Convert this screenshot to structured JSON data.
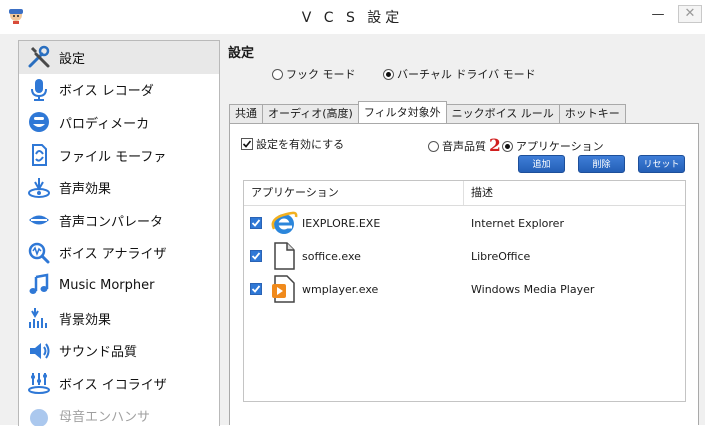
{
  "window": {
    "title": "V C S 設定",
    "minimize": "—",
    "close": "✕"
  },
  "sidebar": {
    "items": [
      {
        "label": "設定",
        "icon": "tools-icon"
      },
      {
        "label": "ボイス レコーダ",
        "icon": "microphone-icon"
      },
      {
        "label": "パロディメーカ",
        "icon": "parody-face-icon"
      },
      {
        "label": "ファイル モーファ",
        "icon": "file-morph-icon"
      },
      {
        "label": "音声効果",
        "icon": "voice-effect-icon"
      },
      {
        "label": "音声コンパレータ",
        "icon": "lips-compare-icon"
      },
      {
        "label": "ボイス アナライザ",
        "icon": "voice-analyzer-icon"
      },
      {
        "label": "Music Morpher",
        "icon": "music-note-icon"
      },
      {
        "label": "背景効果",
        "icon": "background-effect-icon"
      },
      {
        "label": "サウンド品質",
        "icon": "speaker-icon"
      },
      {
        "label": "ボイス イコライザ",
        "icon": "equalizer-icon"
      },
      {
        "label": "母音エンハンサ",
        "icon": "vowel-enhancer-icon"
      }
    ]
  },
  "main": {
    "title": "設定",
    "hook_mode_label": "フック モード",
    "virtual_mode_label": "バーチャル ドライバ モード",
    "tabs": [
      "共通",
      "オーディオ(高度)",
      "フィルタ対象外",
      "ニックボイス ルール",
      "ホットキー"
    ],
    "active_tab": "フィルタ対象外",
    "enable_label": "設定を有効にする",
    "voice_quality_label": "音声品質",
    "step_marker": "2",
    "application_label": "アプリケーション",
    "add_label": "追加",
    "delete_label": "削除",
    "reset_label": "リセット",
    "list": {
      "columns": [
        "アプリケーション",
        "描述"
      ],
      "rows": [
        {
          "name": "IEXPLORE.EXE",
          "desc": "Internet Explorer",
          "checked": true,
          "icon": "internet-explorer-icon"
        },
        {
          "name": "soffice.exe",
          "desc": "LibreOffice",
          "checked": true,
          "icon": "document-file-icon"
        },
        {
          "name": "wmplayer.exe",
          "desc": "Windows Media Player",
          "checked": true,
          "icon": "media-player-icon"
        }
      ]
    }
  },
  "colors": {
    "accent": "#2f78d6",
    "step_marker": "#d11f1f"
  }
}
